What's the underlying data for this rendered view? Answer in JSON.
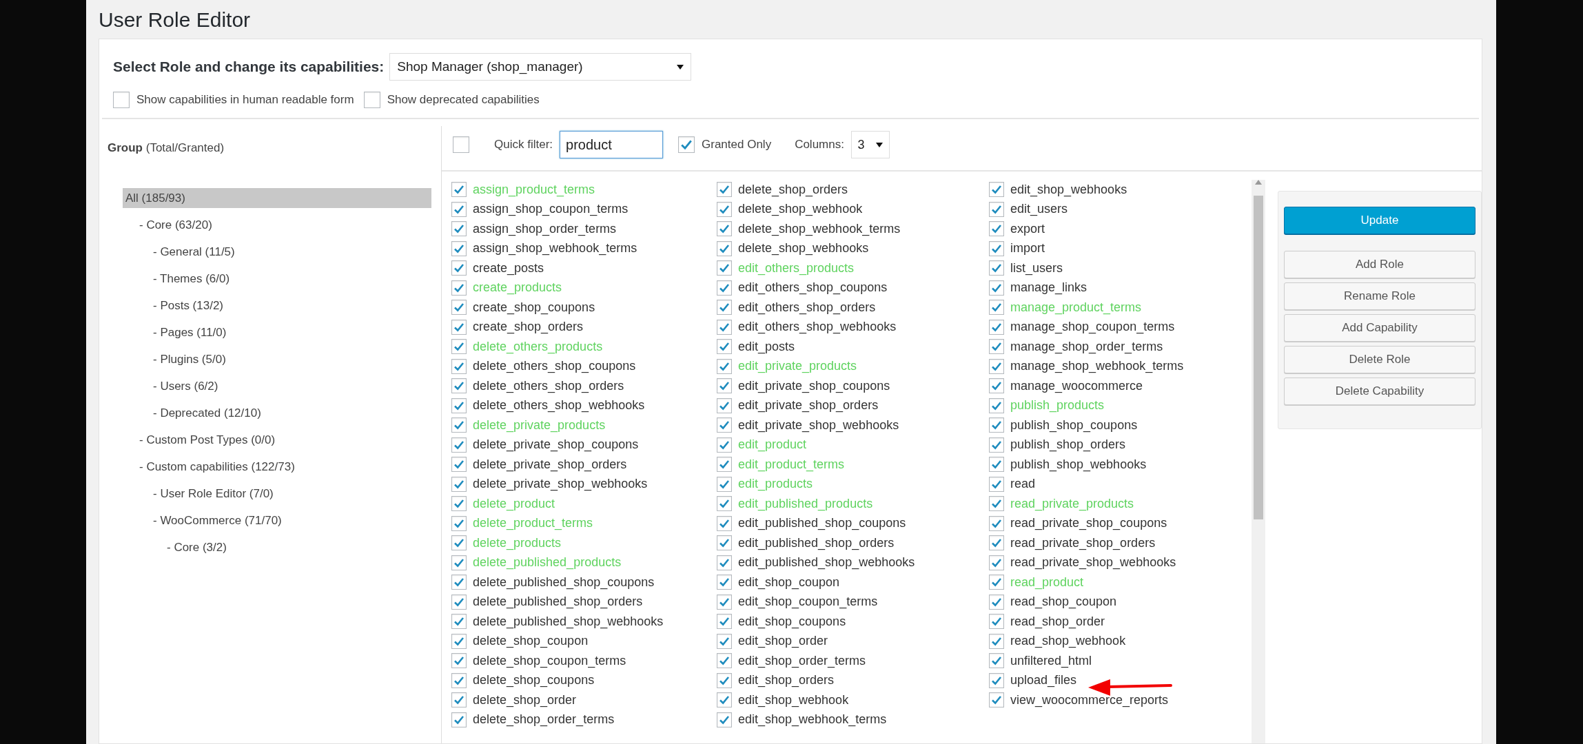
{
  "page": {
    "title": "User Role Editor"
  },
  "role_select": {
    "label": "Select Role and change its capabilities:",
    "value": "Shop Manager (shop_manager)"
  },
  "options": [
    {
      "label": "Show capabilities in human readable form",
      "checked": false
    },
    {
      "label": "Show deprecated capabilities",
      "checked": false
    }
  ],
  "groups": {
    "header": "**Group** (Total/Granted)",
    "tree": [
      {
        "label": "All (185/93)",
        "selected": true,
        "children": [
          {
            "label": "- Core (63/20)",
            "selected": false,
            "children": [
              {
                "label": "- General (11/5)",
                "selected": false
              },
              {
                "label": "- Themes (6/0)",
                "selected": false
              },
              {
                "label": "- Posts (13/2)",
                "selected": false
              },
              {
                "label": "- Pages (11/0)",
                "selected": false
              },
              {
                "label": "- Plugins (5/0)",
                "selected": false
              },
              {
                "label": "- Users (6/2)",
                "selected": false
              },
              {
                "label": "- Deprecated (12/10)",
                "selected": false
              }
            ]
          },
          {
            "label": "- Custom Post Types (0/0)",
            "selected": false
          },
          {
            "label": "- Custom capabilities (122/73)",
            "selected": false,
            "children": [
              {
                "label": "- User Role Editor (7/0)",
                "selected": false
              },
              {
                "label": "- WooCommerce (71/70)",
                "selected": false,
                "children": [
                  {
                    "label": "- Core (3/2)",
                    "selected": false
                  }
                ]
              }
            ]
          }
        ]
      }
    ]
  },
  "capabilities": {
    "select_all": {
      "checked": false
    },
    "quick_filter": {
      "label": "Quick filter:",
      "value": "product"
    },
    "granted_only": {
      "label": "Granted Only",
      "checked": true
    },
    "columns": {
      "label": "Columns:",
      "value": "3"
    },
    "columns_list": [
      [
        {
          "name": "assign_product_terms",
          "checked": true,
          "highlighted": true
        },
        {
          "name": "assign_shop_coupon_terms",
          "checked": true,
          "highlighted": false
        },
        {
          "name": "assign_shop_order_terms",
          "checked": true,
          "highlighted": false
        },
        {
          "name": "assign_shop_webhook_terms",
          "checked": true,
          "highlighted": false
        },
        {
          "name": "create_posts",
          "checked": true,
          "highlighted": false
        },
        {
          "name": "create_products",
          "checked": true,
          "highlighted": true
        },
        {
          "name": "create_shop_coupons",
          "checked": true,
          "highlighted": false
        },
        {
          "name": "create_shop_orders",
          "checked": true,
          "highlighted": false
        },
        {
          "name": "delete_others_products",
          "checked": true,
          "highlighted": true
        },
        {
          "name": "delete_others_shop_coupons",
          "checked": true,
          "highlighted": false
        },
        {
          "name": "delete_others_shop_orders",
          "checked": true,
          "highlighted": false
        },
        {
          "name": "delete_others_shop_webhooks",
          "checked": true,
          "highlighted": false
        },
        {
          "name": "delete_private_products",
          "checked": true,
          "highlighted": true
        },
        {
          "name": "delete_private_shop_coupons",
          "checked": true,
          "highlighted": false
        },
        {
          "name": "delete_private_shop_orders",
          "checked": true,
          "highlighted": false
        },
        {
          "name": "delete_private_shop_webhooks",
          "checked": true,
          "highlighted": false
        },
        {
          "name": "delete_product",
          "checked": true,
          "highlighted": true
        },
        {
          "name": "delete_product_terms",
          "checked": true,
          "highlighted": true
        },
        {
          "name": "delete_products",
          "checked": true,
          "highlighted": true
        },
        {
          "name": "delete_published_products",
          "checked": true,
          "highlighted": true
        },
        {
          "name": "delete_published_shop_coupons",
          "checked": true,
          "highlighted": false
        },
        {
          "name": "delete_published_shop_orders",
          "checked": true,
          "highlighted": false
        },
        {
          "name": "delete_published_shop_webhooks",
          "checked": true,
          "highlighted": false
        },
        {
          "name": "delete_shop_coupon",
          "checked": true,
          "highlighted": false
        },
        {
          "name": "delete_shop_coupon_terms",
          "checked": true,
          "highlighted": false
        },
        {
          "name": "delete_shop_coupons",
          "checked": true,
          "highlighted": false
        },
        {
          "name": "delete_shop_order",
          "checked": true,
          "highlighted": false
        },
        {
          "name": "delete_shop_order_terms",
          "checked": true,
          "highlighted": false
        }
      ],
      [
        {
          "name": "delete_shop_orders",
          "checked": true,
          "highlighted": false
        },
        {
          "name": "delete_shop_webhook",
          "checked": true,
          "highlighted": false
        },
        {
          "name": "delete_shop_webhook_terms",
          "checked": true,
          "highlighted": false
        },
        {
          "name": "delete_shop_webhooks",
          "checked": true,
          "highlighted": false
        },
        {
          "name": "edit_others_products",
          "checked": true,
          "highlighted": true
        },
        {
          "name": "edit_others_shop_coupons",
          "checked": true,
          "highlighted": false
        },
        {
          "name": "edit_others_shop_orders",
          "checked": true,
          "highlighted": false
        },
        {
          "name": "edit_others_shop_webhooks",
          "checked": true,
          "highlighted": false
        },
        {
          "name": "edit_posts",
          "checked": true,
          "highlighted": false
        },
        {
          "name": "edit_private_products",
          "checked": true,
          "highlighted": true
        },
        {
          "name": "edit_private_shop_coupons",
          "checked": true,
          "highlighted": false
        },
        {
          "name": "edit_private_shop_orders",
          "checked": true,
          "highlighted": false
        },
        {
          "name": "edit_private_shop_webhooks",
          "checked": true,
          "highlighted": false
        },
        {
          "name": "edit_product",
          "checked": true,
          "highlighted": true
        },
        {
          "name": "edit_product_terms",
          "checked": true,
          "highlighted": true
        },
        {
          "name": "edit_products",
          "checked": true,
          "highlighted": true
        },
        {
          "name": "edit_published_products",
          "checked": true,
          "highlighted": true
        },
        {
          "name": "edit_published_shop_coupons",
          "checked": true,
          "highlighted": false
        },
        {
          "name": "edit_published_shop_orders",
          "checked": true,
          "highlighted": false
        },
        {
          "name": "edit_published_shop_webhooks",
          "checked": true,
          "highlighted": false
        },
        {
          "name": "edit_shop_coupon",
          "checked": true,
          "highlighted": false
        },
        {
          "name": "edit_shop_coupon_terms",
          "checked": true,
          "highlighted": false
        },
        {
          "name": "edit_shop_coupons",
          "checked": true,
          "highlighted": false
        },
        {
          "name": "edit_shop_order",
          "checked": true,
          "highlighted": false
        },
        {
          "name": "edit_shop_order_terms",
          "checked": true,
          "highlighted": false
        },
        {
          "name": "edit_shop_orders",
          "checked": true,
          "highlighted": false
        },
        {
          "name": "edit_shop_webhook",
          "checked": true,
          "highlighted": false
        },
        {
          "name": "edit_shop_webhook_terms",
          "checked": true,
          "highlighted": false
        }
      ],
      [
        {
          "name": "edit_shop_webhooks",
          "checked": true,
          "highlighted": false
        },
        {
          "name": "edit_users",
          "checked": true,
          "highlighted": false
        },
        {
          "name": "export",
          "checked": true,
          "highlighted": false
        },
        {
          "name": "import",
          "checked": true,
          "highlighted": false
        },
        {
          "name": "list_users",
          "checked": true,
          "highlighted": false
        },
        {
          "name": "manage_links",
          "checked": true,
          "highlighted": false
        },
        {
          "name": "manage_product_terms",
          "checked": true,
          "highlighted": true
        },
        {
          "name": "manage_shop_coupon_terms",
          "checked": true,
          "highlighted": false
        },
        {
          "name": "manage_shop_order_terms",
          "checked": true,
          "highlighted": false
        },
        {
          "name": "manage_shop_webhook_terms",
          "checked": true,
          "highlighted": false
        },
        {
          "name": "manage_woocommerce",
          "checked": true,
          "highlighted": false
        },
        {
          "name": "publish_products",
          "checked": true,
          "highlighted": true
        },
        {
          "name": "publish_shop_coupons",
          "checked": true,
          "highlighted": false
        },
        {
          "name": "publish_shop_orders",
          "checked": true,
          "highlighted": false
        },
        {
          "name": "publish_shop_webhooks",
          "checked": true,
          "highlighted": false
        },
        {
          "name": "read",
          "checked": true,
          "highlighted": false
        },
        {
          "name": "read_private_products",
          "checked": true,
          "highlighted": true
        },
        {
          "name": "read_private_shop_coupons",
          "checked": true,
          "highlighted": false
        },
        {
          "name": "read_private_shop_orders",
          "checked": true,
          "highlighted": false
        },
        {
          "name": "read_private_shop_webhooks",
          "checked": true,
          "highlighted": false
        },
        {
          "name": "read_product",
          "checked": true,
          "highlighted": true
        },
        {
          "name": "read_shop_coupon",
          "checked": true,
          "highlighted": false
        },
        {
          "name": "read_shop_order",
          "checked": true,
          "highlighted": false
        },
        {
          "name": "read_shop_webhook",
          "checked": true,
          "highlighted": false
        },
        {
          "name": "unfiltered_html",
          "checked": true,
          "highlighted": false
        },
        {
          "name": "upload_files",
          "checked": true,
          "highlighted": false
        },
        {
          "name": "view_woocommerce_reports",
          "checked": true,
          "highlighted": false
        }
      ]
    ]
  },
  "actions": [
    {
      "label": "Update",
      "kind": "primary"
    },
    {
      "label": "Add Role",
      "kind": "secondary"
    },
    {
      "label": "Rename Role",
      "kind": "secondary"
    },
    {
      "label": "Add Capability",
      "kind": "secondary"
    },
    {
      "label": "Delete Role",
      "kind": "secondary"
    },
    {
      "label": "Delete Capability",
      "kind": "secondary"
    }
  ]
}
